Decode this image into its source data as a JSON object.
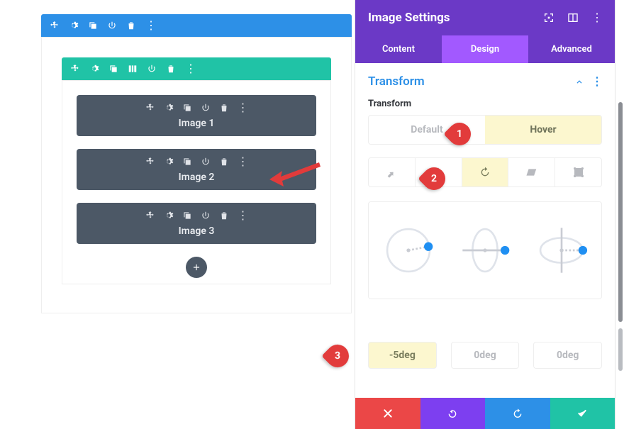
{
  "canvas": {
    "modules": [
      {
        "label": "Image 1"
      },
      {
        "label": "Image 2"
      },
      {
        "label": "Image 3"
      }
    ]
  },
  "panel": {
    "title": "Image Settings",
    "tabs": {
      "content": "Content",
      "design": "Design",
      "advanced": "Advanced"
    },
    "section_title": "Transform",
    "field_label": "Transform",
    "states": {
      "default": "Default",
      "hover": "Hover"
    },
    "values": {
      "v1": "-5deg",
      "v2": "0deg",
      "v3": "0deg"
    }
  },
  "callouts": {
    "c1": "1",
    "c2": "2",
    "c3": "3"
  }
}
